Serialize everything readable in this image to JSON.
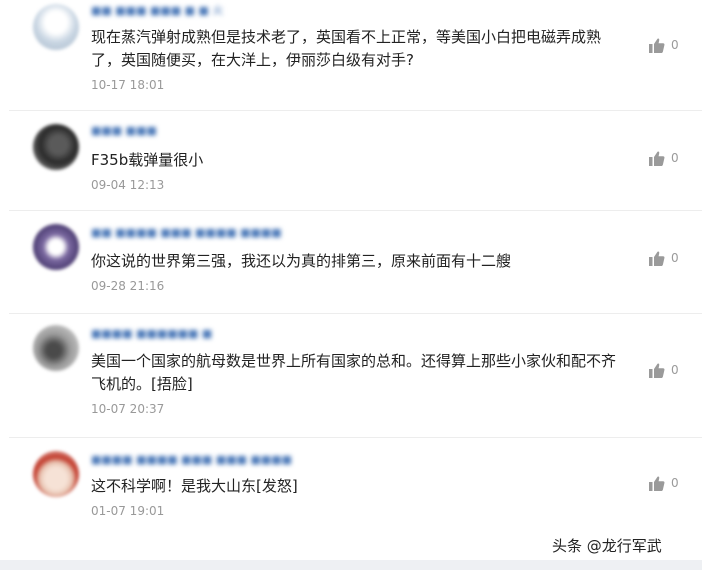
{
  "comments": [
    {
      "username": "■■ ■■■ ■■■ ■ ■ 火",
      "text": "现在蒸汽弹射成熟但是技术老了，英国看不上正常，等美国小白把电磁弄成熟了，英国随便买，在大洋上，伊丽莎白级有对手?",
      "time": "10-17 18:01",
      "likes": "0",
      "avatar_colors": [
        "#e8eef4",
        "#b9c8d8"
      ]
    },
    {
      "username": "■■■ ■■■",
      "text": "F35b载弹量很小",
      "time": "09-04 12:13",
      "likes": "0",
      "avatar_colors": [
        "#3a3a3a",
        "#8a8a8a"
      ]
    },
    {
      "username": "■■ ■■■■ ■■■ ■■■■ ■■■■",
      "text": "你这说的世界第三强，我还以为真的排第三，原来前面有十二艘",
      "time": "09-28 21:16",
      "likes": "0",
      "avatar_colors": [
        "#6a5a8c",
        "#c6c0d8"
      ]
    },
    {
      "username": "■■■■ ■■■■■■ ■",
      "text": "美国一个国家的航母数是世界上所有国家的总和。还得算上那些小家伙和配不齐飞机的。[捂脸]",
      "time": "10-07 20:37",
      "likes": "0",
      "avatar_colors": [
        "#6e6e6e",
        "#d9d9d9"
      ]
    },
    {
      "username": "■■■■ ■■■■ ■■■ ■■■ ■■■■",
      "text": "这不科学啊！是我大山东[发怒]",
      "time": "01-07 19:01",
      "likes": "0",
      "avatar_colors": [
        "#c0392b",
        "#f3d6c6"
      ]
    }
  ],
  "watermark": "头条 @龙行军武"
}
